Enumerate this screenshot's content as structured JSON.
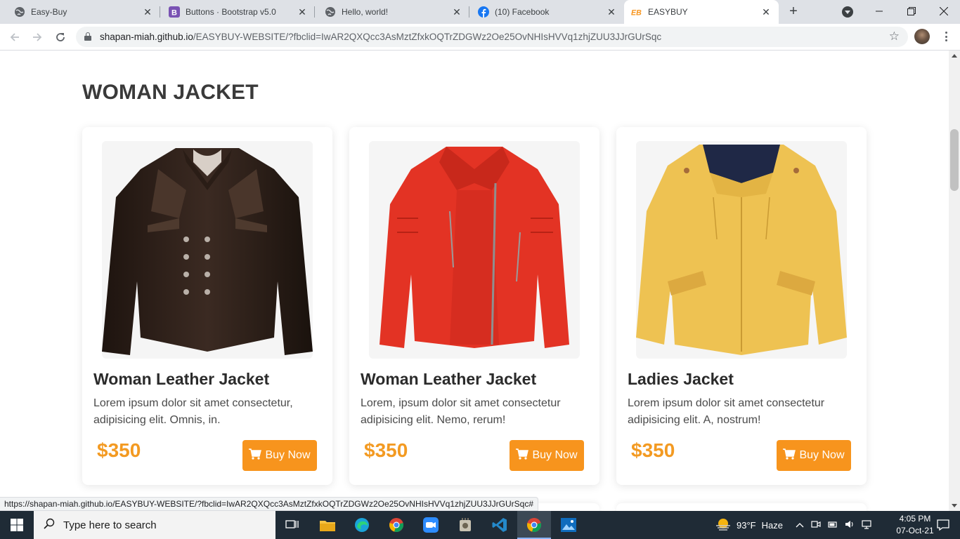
{
  "browser": {
    "tabs": [
      {
        "title": "Easy-Buy",
        "favicon": "globe-icon",
        "active": false
      },
      {
        "title": "Buttons · Bootstrap v5.0",
        "favicon": "bootstrap-icon",
        "active": false
      },
      {
        "title": "Hello, world!",
        "favicon": "globe-icon",
        "active": false
      },
      {
        "title": "(10) Facebook",
        "favicon": "facebook-icon",
        "active": false
      },
      {
        "title": "EASYBUY",
        "favicon": "easybuy-logo-icon",
        "active": true
      }
    ],
    "close_glyph": "✕",
    "new_tab_glyph": "+",
    "url_host": "shapan-miah.github.io",
    "url_path": "/EASYBUY-WEBSITE/?fbclid=IwAR2QXQcc3AsMztZfxkOQTrZDGWz2Oe25OvNHIsHVVq1zhjZUU3JJrGUrSqc",
    "status_url": "https://shapan-miah.github.io/EASYBUY-WEBSITE/?fbclid=IwAR2QXQcc3AsMztZfxkOQTrZDGWz2Oe25OvNHIsHVVq1zhjZUU3JJrGUrSqc#"
  },
  "page": {
    "section_title": "WOMAN JACKET",
    "products": [
      {
        "name": "Woman Leather Jacket",
        "description": "Lorem ipsum dolor sit amet consectetur, adipisicing elit. Omnis, in.",
        "price": "$350",
        "button_label": "Buy Now",
        "image": "brown-leather-jacket"
      },
      {
        "name": "Woman Leather Jacket",
        "description": "Lorem, ipsum dolor sit amet consectetur adipisicing elit. Nemo, rerum!",
        "price": "$350",
        "button_label": "Buy Now",
        "image": "red-leather-jacket"
      },
      {
        "name": "Ladies Jacket",
        "description": "Lorem ipsum dolor sit amet consectetur adipisicing elit. A, nostrum!",
        "price": "$350",
        "button_label": "Buy Now",
        "image": "yellow-hooded-jacket"
      }
    ],
    "colors": {
      "accent": "#f7941d",
      "price": "#f39a22"
    }
  },
  "taskbar": {
    "search_placeholder": "Type here to search",
    "weather_temp": "93°F",
    "weather_text": "Haze",
    "time": "4:05 PM",
    "date": "07-Oct-21"
  }
}
